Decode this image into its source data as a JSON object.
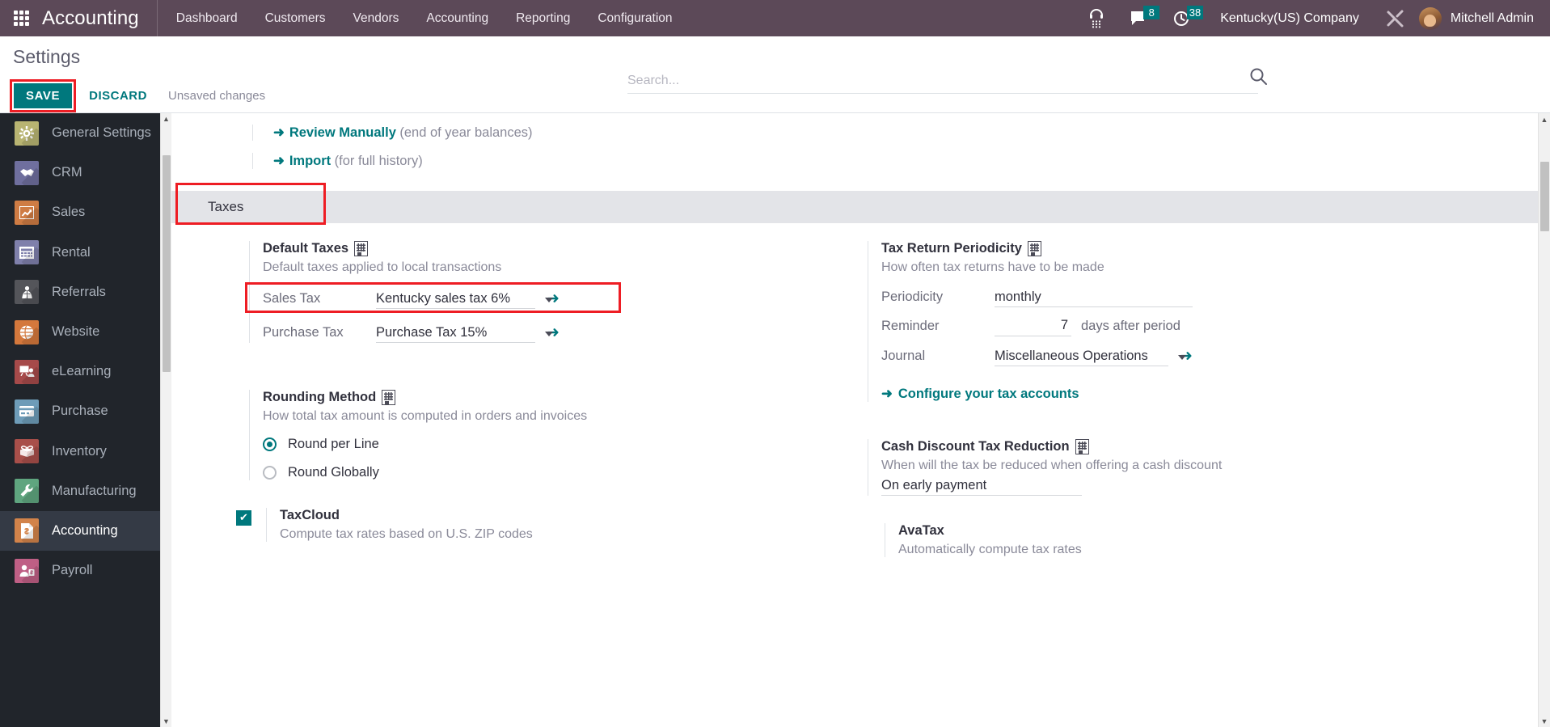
{
  "navbar": {
    "apps_icon": "apps-grid-icon",
    "brand": "Accounting",
    "menus": [
      "Dashboard",
      "Customers",
      "Vendors",
      "Accounting",
      "Reporting",
      "Configuration"
    ],
    "voip_icon": "voip-phone-icon",
    "messages_icon": "messages-icon",
    "messages_count": "8",
    "activities_icon": "activities-clock-icon",
    "activities_count": "38",
    "company": "Kentucky(US) Company",
    "tools_icon": "debug-tools-icon",
    "avatar": "user-avatar",
    "user": "Mitchell Admin"
  },
  "control_panel": {
    "title": "Settings",
    "save_label": "SAVE",
    "discard_label": "DISCARD",
    "status": "Unsaved changes",
    "search_placeholder": "Search...",
    "search_value": "",
    "search_icon": "search-icon"
  },
  "sidebar": {
    "items": [
      {
        "label": "General Settings",
        "icon": "gear-icon",
        "color": "#b8b472",
        "active": false
      },
      {
        "label": "CRM",
        "icon": "handshake-icon",
        "color": "#6f6f9e",
        "active": false
      },
      {
        "label": "Sales",
        "icon": "chart-up-icon",
        "color": "#cf7c44",
        "active": false
      },
      {
        "label": "Rental",
        "icon": "calendar-card-icon",
        "color": "#7f80ab",
        "active": false
      },
      {
        "label": "Referrals",
        "icon": "people-icon",
        "color": "#54555a",
        "active": false
      },
      {
        "label": "Website",
        "icon": "globe-icon",
        "color": "#d4783c",
        "active": false
      },
      {
        "label": "eLearning",
        "icon": "presentation-icon",
        "color": "#a64a4a",
        "active": false
      },
      {
        "label": "Purchase",
        "icon": "credit-card-icon",
        "color": "#6e9cb8",
        "active": false
      },
      {
        "label": "Inventory",
        "icon": "open-box-icon",
        "color": "#a84f4a",
        "active": false
      },
      {
        "label": "Manufacturing",
        "icon": "wrench-icon",
        "color": "#5fa57f",
        "active": false
      },
      {
        "label": "Accounting",
        "icon": "invoice-dollar-icon",
        "color": "#d2834a",
        "active": true
      },
      {
        "label": "Payroll",
        "icon": "person-money-icon",
        "color": "#bf5f85",
        "active": false
      }
    ],
    "scroll_up_icon": "scroll-up-arrow",
    "scroll_down_icon": "scroll-down-arrow"
  },
  "pane": {
    "scroll_up_icon": "scroll-up-arrow",
    "scroll_down_icon": "scroll-down-arrow",
    "top_links": [
      {
        "arrow": "arrow-right-icon",
        "label": "Review Manually",
        "note": "(end of year balances)"
      },
      {
        "arrow": "arrow-right-icon",
        "label": "Import",
        "note": "(for full history)"
      }
    ],
    "section_title": "Taxes",
    "default_taxes": {
      "title": "Default Taxes",
      "company_icon": "company-building-icon",
      "desc": "Default taxes applied to local transactions",
      "rows": [
        {
          "label": "Sales Tax",
          "value": "Kentucky sales tax 6%",
          "chevron": "chevron-down-icon",
          "arrow": "arrow-right-icon",
          "highlighted": true
        },
        {
          "label": "Purchase Tax",
          "value": "Purchase Tax 15%",
          "chevron": "chevron-down-icon",
          "arrow": "arrow-right-icon",
          "highlighted": false
        }
      ]
    },
    "rounding": {
      "title": "Rounding Method",
      "company_icon": "company-building-icon",
      "desc": "How total tax amount is computed in orders and invoices",
      "options": [
        {
          "label": "Round per Line",
          "selected": true
        },
        {
          "label": "Round Globally",
          "selected": false
        }
      ]
    },
    "taxcloud": {
      "title": "TaxCloud",
      "desc": "Compute tax rates based on U.S. ZIP codes",
      "checked": true
    },
    "periodicity": {
      "title": "Tax Return Periodicity",
      "company_icon": "company-building-icon",
      "desc": "How often tax returns have to be made",
      "periodicity_label": "Periodicity",
      "periodicity_value": "monthly",
      "reminder_label": "Reminder",
      "reminder_value": "7",
      "reminder_suffix": "days after period",
      "journal_label": "Journal",
      "journal_value": "Miscellaneous Operations",
      "journal_chevron": "chevron-down-icon",
      "journal_arrow": "arrow-right-icon",
      "configure_link": "Configure your tax accounts",
      "configure_arrow": "arrow-right-icon"
    },
    "cash_discount": {
      "title": "Cash Discount Tax Reduction",
      "company_icon": "company-building-icon",
      "desc": "When will the tax be reduced when offering a cash discount",
      "value": "On early payment"
    },
    "avatax": {
      "title": "AvaTax",
      "desc": "Automatically compute tax rates",
      "checked": false
    }
  },
  "colors": {
    "navbar": "#5c4958",
    "accent_teal": "#00787d",
    "highlight_red": "#ee1d24",
    "sidebar_bg": "#21252b",
    "section_band": "#e3e4e8"
  }
}
